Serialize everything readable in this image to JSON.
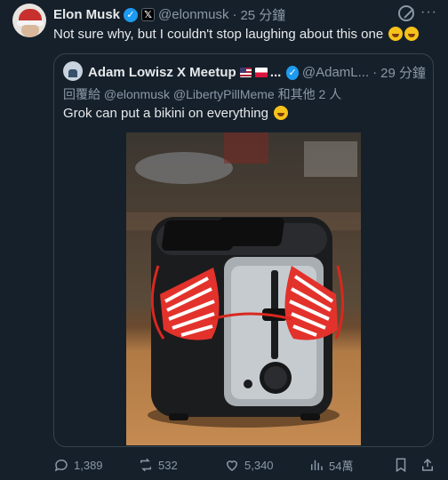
{
  "tweet": {
    "author_name": "Elon Musk",
    "handle": "@elonmusk",
    "separator": "·",
    "time": "25 分鐘",
    "text": "Not sure why, but I couldn't stop laughing about this one"
  },
  "quote": {
    "author_name": "Adam Lowisz X Meetup",
    "ellipsis": "...",
    "handle": "@AdamL...",
    "separator": "·",
    "time": "29 分鐘",
    "reply_prefix": "回覆給",
    "reply_to_1": "@elonmusk",
    "reply_to_2": "@LibertyPillMeme",
    "reply_suffix": "和其他 2 人",
    "text": "Grok can put a bikini on everything"
  },
  "actions": {
    "replies": "1,389",
    "reposts": "532",
    "likes": "5,340",
    "views": "54萬"
  },
  "icons": {
    "verified": "verified-badge-icon",
    "x_affiliation": "x-logo-icon",
    "grok": "grok-icon",
    "more": "more-icon",
    "reply": "reply-icon",
    "repost": "repost-icon",
    "like": "heart-icon",
    "views": "views-icon",
    "bookmark": "bookmark-icon",
    "share": "share-icon"
  },
  "colors": {
    "background": "#15202b",
    "text": "#e7e9ea",
    "muted": "#8b98a5",
    "verified": "#1d9bf0",
    "border": "#38444d"
  }
}
